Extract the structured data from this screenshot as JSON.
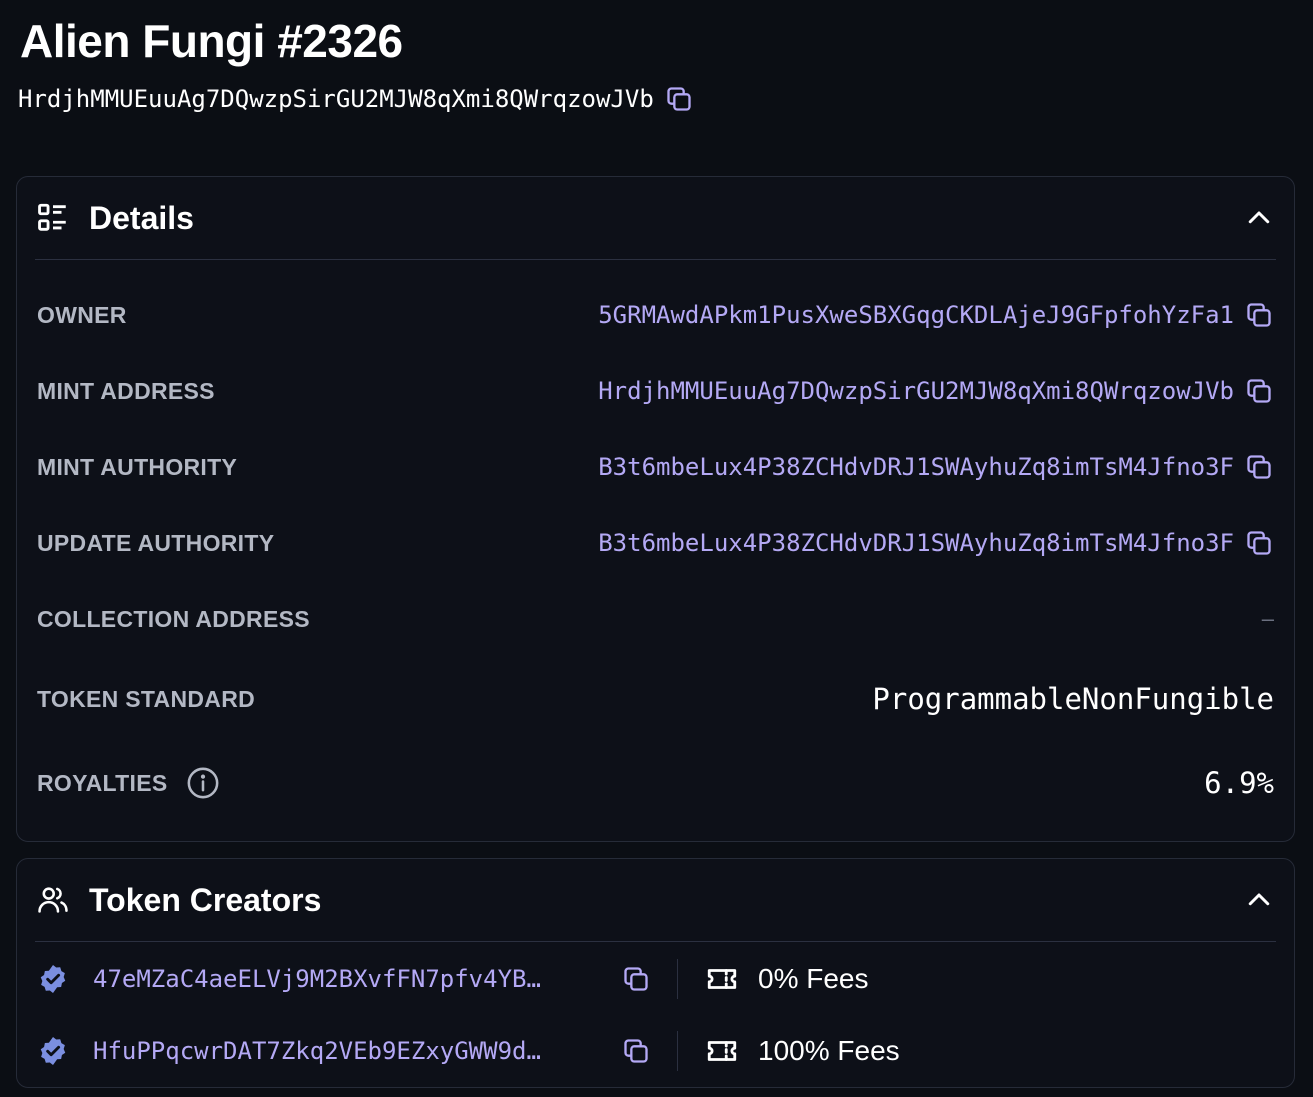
{
  "page": {
    "title": "Alien Fungi #2326",
    "mint_address": "HrdjhMMUEuuAg7DQwzpSirGU2MJW8qXmi8QWrqzowJVb"
  },
  "details": {
    "heading": "Details",
    "rows": [
      {
        "label": "OWNER",
        "value": "5GRMAwdAPkm1PusXweSBXGqgCKDLAjeJ9GFpfohYzFa1"
      },
      {
        "label": "MINT ADDRESS",
        "value": "HrdjhMMUEuuAg7DQwzpSirGU2MJW8qXmi8QWrqzowJVb"
      },
      {
        "label": "MINT AUTHORITY",
        "value": "B3t6mbeLux4P38ZCHdvDRJ1SWAyhuZq8imTsM4Jfno3F"
      },
      {
        "label": "UPDATE AUTHORITY",
        "value": "B3t6mbeLux4P38ZCHdvDRJ1SWAyhuZq8imTsM4Jfno3F"
      },
      {
        "label": "COLLECTION ADDRESS",
        "value": "–"
      },
      {
        "label": "TOKEN STANDARD",
        "value": "ProgrammableNonFungible"
      },
      {
        "label": "ROYALTIES",
        "value": "6.9%"
      }
    ]
  },
  "creators": {
    "heading": "Token Creators",
    "items": [
      {
        "address": "47eMZaC4aeELVj9M2BXvfFN7pfv4YB…",
        "fees": "0% Fees"
      },
      {
        "address": "HfuPPqcwrDAT7Zkq2VEb9EZxyGWW9d…",
        "fees": "100% Fees"
      }
    ]
  },
  "icons": {
    "copy": "copy-icon",
    "details": "details-list-icon",
    "collapse": "chevron-up-icon",
    "info": "info-icon",
    "users": "users-icon",
    "verified": "verified-badge-icon",
    "ticket": "ticket-icon"
  },
  "colors": {
    "background": "#0b0e14",
    "link": "#b4a9f5",
    "label": "#b3b8c4",
    "verified": "#7b8fe0"
  }
}
